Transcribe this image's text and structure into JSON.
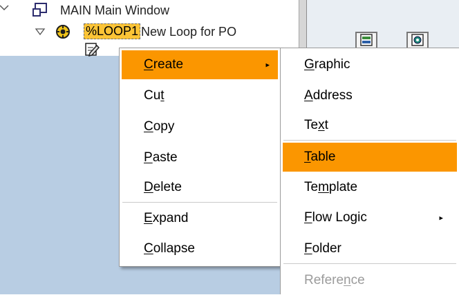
{
  "tree": {
    "row1": {
      "label": "MAIN Main Window"
    },
    "row2": {
      "name_highlight": "%LOOP1",
      "label": "New Loop for PO"
    }
  },
  "context_menu": {
    "items": [
      {
        "label": "Create",
        "mnemonic_index": 0,
        "has_submenu": true,
        "state": "active"
      },
      {
        "label": "Cut",
        "mnemonic_index": 2
      },
      {
        "label": "Copy",
        "mnemonic_index": 0
      },
      {
        "label": "Paste",
        "mnemonic_index": 0
      },
      {
        "label": "Delete",
        "mnemonic_index": 0
      },
      {
        "label": "Expand",
        "mnemonic_index": 0
      },
      {
        "label": "Collapse",
        "mnemonic_index": 0
      }
    ]
  },
  "create_submenu": {
    "items": [
      {
        "label": "Graphic",
        "mnemonic_index": 0
      },
      {
        "label": "Address",
        "mnemonic_index": 0
      },
      {
        "label": "Text",
        "mnemonic_index": 2
      },
      {
        "label": "Table",
        "mnemonic_index": 0,
        "state": "active"
      },
      {
        "label": "Template",
        "mnemonic_index": 2
      },
      {
        "label": "Flow Logic",
        "mnemonic_index": 0,
        "has_submenu": true
      },
      {
        "label": "Folder",
        "mnemonic_index": 0
      },
      {
        "label": "Reference",
        "mnemonic_index": 6,
        "state": "disabled"
      }
    ]
  },
  "colors": {
    "highlight": "#fb9600",
    "tree_selection": "#fbc436",
    "tree_background": "#b8cde3",
    "disabled_text": "#9b9b9b"
  },
  "icons": {
    "row1": "window-node-icon",
    "row2_expander": "collapse-triangle-icon",
    "row2": "loop-node-icon",
    "row3": "text-edit-icon",
    "toolbar": [
      "form-painter-icon",
      "graphic-icon"
    ]
  }
}
